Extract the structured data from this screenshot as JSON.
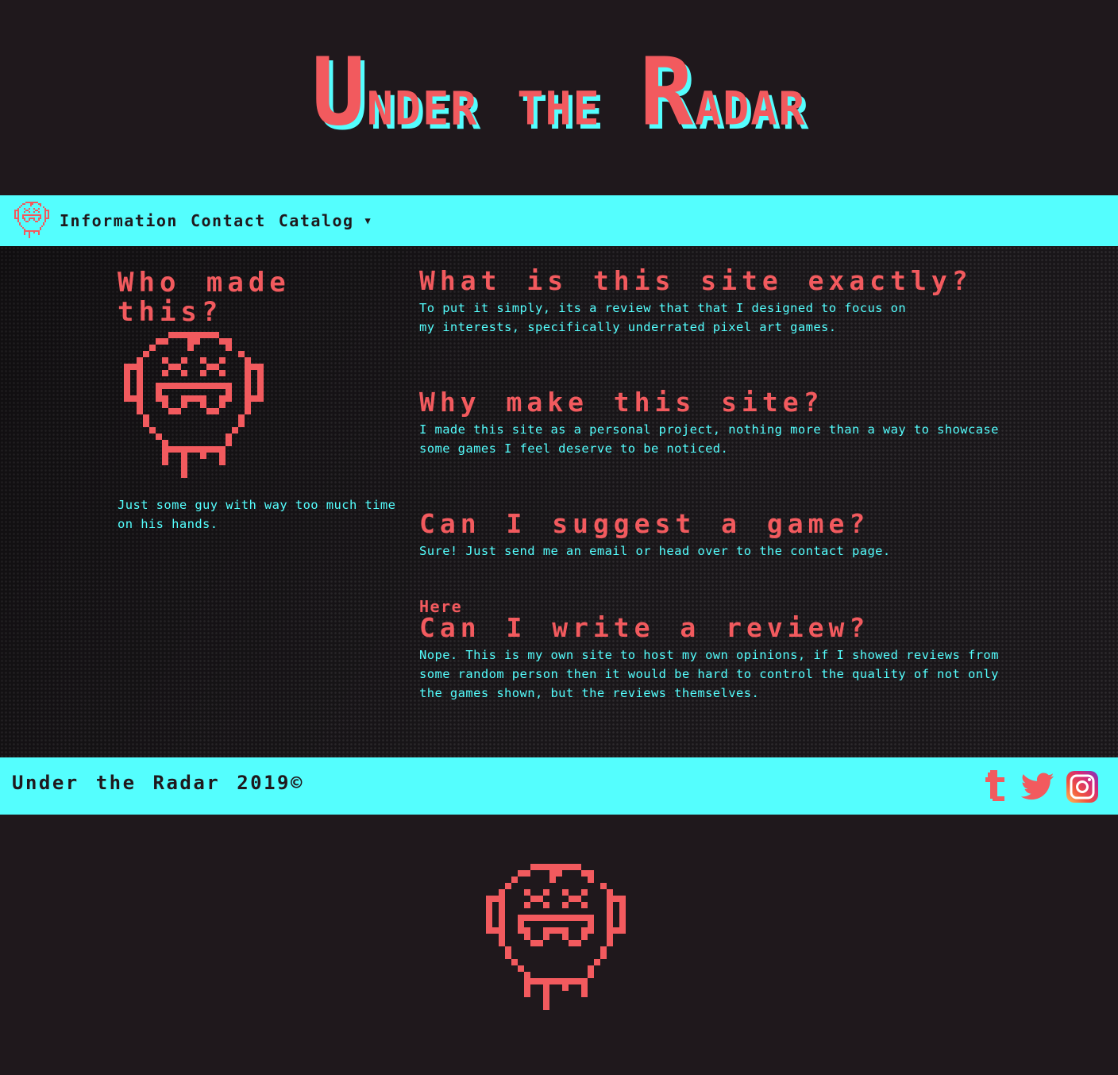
{
  "header": {
    "logo_first_u": "U",
    "logo_nder": "nder",
    "logo_the": "the",
    "logo_r": "R",
    "logo_adar": "adar"
  },
  "nav": {
    "items": [
      "Information",
      "Contact",
      "Catalog"
    ],
    "dropdown_icon": "caret-down-icon",
    "logo_icon": "skull-face-icon"
  },
  "about": {
    "title": "Who made this?",
    "caption": "Just some guy with way too much time on his hands."
  },
  "faq": [
    {
      "question": "What is this site exactly?",
      "answer": "To put it simply, its a review that that I designed to focus on my interests, specifically underrated pixel art games."
    },
    {
      "question": "Why make this site?",
      "answer": "I made this site as a personal project, nothing more than a way to showcase some games I feel deserve to be noticed."
    },
    {
      "question": "Can I suggest a game?",
      "answer": "Sure! Just send me an email or head over to the contact page.",
      "link": "Here"
    },
    {
      "question": "Can I write a review?",
      "answer": "Nope. This is my own site to host my own opinions, if I showed reviews from some random person then it would be hard to control the quality of not only the games shown, but the reviews themselves."
    }
  ],
  "footer": {
    "copyright": "Under the Radar 2019©",
    "social_icons": [
      "tumblr-icon",
      "twitter-icon",
      "instagram-icon"
    ]
  },
  "colors": {
    "accent_red": "#f25a5e",
    "accent_cyan": "#54fefe",
    "background": "#1f181c"
  }
}
